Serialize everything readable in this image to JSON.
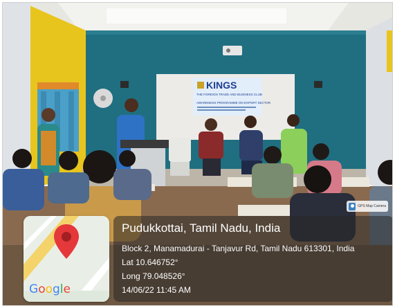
{
  "photo": {
    "banner_brand": "KINGS",
    "banner_line_1": "THE FOREIGN TRADE AND BUSINESS CLUB",
    "banner_line_2": "AWARENESS PROGRAMME ON EXPORT SECTOR"
  },
  "gps_badge": {
    "label": "GPS Map Camera"
  },
  "location": {
    "title": "Pudukkottai, Tamil Nadu, India",
    "address": "Block 2, Manamadurai - Tanjavur Rd, Tamil Nadu 613301, India",
    "lat": "Lat 10.646752°",
    "long": "Long 79.048526°",
    "datetime": "14/06/22 11:45 AM"
  },
  "map_card": {
    "google_letters": [
      "G",
      "o",
      "o",
      "g",
      "l",
      "e"
    ],
    "google_colors": [
      "#4285F4",
      "#EA4335",
      "#FBBC05",
      "#4285F4",
      "#34A853",
      "#EA4335"
    ],
    "pin_color": "#e5383b"
  }
}
